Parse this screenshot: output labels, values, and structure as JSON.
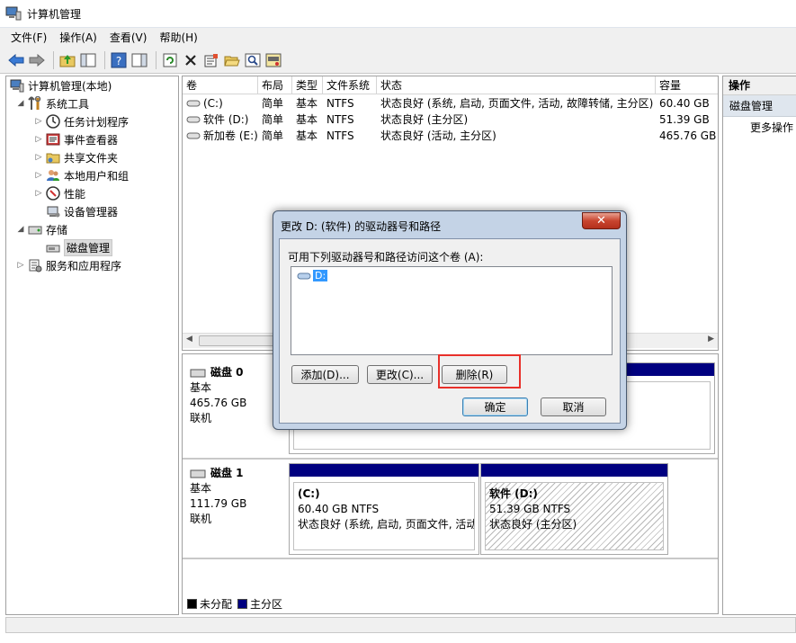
{
  "window": {
    "title": "计算机管理"
  },
  "menu": [
    "文件(F)",
    "操作(A)",
    "查看(V)",
    "帮助(H)"
  ],
  "tree": {
    "root": "计算机管理(本地)",
    "system_tools": "系统工具",
    "task_scheduler": "任务计划程序",
    "event_viewer": "事件查看器",
    "shared_folders": "共享文件夹",
    "local_users": "本地用户和组",
    "performance": "性能",
    "device_manager": "设备管理器",
    "storage": "存储",
    "disk_management": "磁盘管理",
    "services_apps": "服务和应用程序"
  },
  "volumes": {
    "headers": [
      "卷",
      "布局",
      "类型",
      "文件系统",
      "状态",
      "容量"
    ],
    "rows": [
      [
        "(C:)",
        "简单",
        "基本",
        "NTFS",
        "状态良好 (系统, 启动, 页面文件, 活动, 故障转储, 主分区)",
        "60.40 GB"
      ],
      [
        "软件 (D:)",
        "简单",
        "基本",
        "NTFS",
        "状态良好 (主分区)",
        "51.39 GB"
      ],
      [
        "新加卷 (E:)",
        "简单",
        "基本",
        "NTFS",
        "状态良好 (活动, 主分区)",
        "465.76 GB"
      ]
    ]
  },
  "disks": {
    "disk0": {
      "name": "磁盘 0",
      "type": "基本",
      "size": "465.76 GB",
      "status": "联机"
    },
    "disk1": {
      "name": "磁盘 1",
      "type": "基本",
      "size": "111.79 GB",
      "status": "联机",
      "c": {
        "name": "(C:)",
        "size": "60.40 GB NTFS",
        "status": "状态良好 (系统, 启动, 页面文件, 活动"
      },
      "d": {
        "name": "软件  (D:)",
        "size": "51.39 GB NTFS",
        "status": "状态良好 (主分区)"
      }
    }
  },
  "legend": {
    "unallocated": "未分配",
    "primary": "主分区"
  },
  "actions": {
    "header": "操作",
    "sub": "磁盘管理",
    "more": "更多操作"
  },
  "dialog": {
    "title": "更改 D: (软件) 的驱动器号和路径",
    "prompt": "可用下列驱动器号和路径访问这个卷 (A):",
    "list_item": "D:",
    "add": "添加(D)...",
    "change": "更改(C)...",
    "remove": "删除(R)",
    "ok": "确定",
    "cancel": "取消"
  },
  "colors": {
    "primary_partition": "#000080",
    "highlight": "#e8302a"
  }
}
